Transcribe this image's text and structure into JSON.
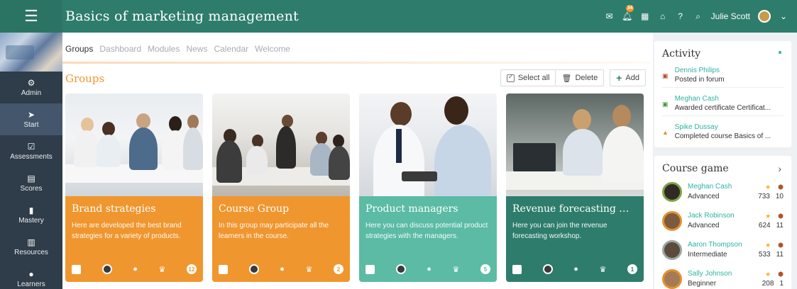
{
  "header": {
    "title": "Basics of marketing management",
    "notification_count": "34",
    "user_name": "Julie Scott"
  },
  "sidebar": {
    "items": [
      {
        "label": "Admin",
        "icon": "gear-icon"
      },
      {
        "label": "Start",
        "icon": "send-icon"
      },
      {
        "label": "Assessments",
        "icon": "checklist-icon"
      },
      {
        "label": "Scores",
        "icon": "scores-icon"
      },
      {
        "label": "Mastery",
        "icon": "bar-chart-icon"
      },
      {
        "label": "Resources",
        "icon": "books-icon"
      },
      {
        "label": "Learners",
        "icon": "person-icon"
      }
    ],
    "active": "Start"
  },
  "tabs": [
    "Groups",
    "Dashboard",
    "Modules",
    "News",
    "Calendar",
    "Welcome"
  ],
  "active_tab": "Groups",
  "section_title": "Groups",
  "actions": {
    "select_all": "Select all",
    "delete": "Delete",
    "add": "Add"
  },
  "cards": [
    {
      "title": "Brand strategies",
      "desc": "Here are developed the best brand strategies for a variety of products.",
      "count": "12",
      "color": "#f0962f"
    },
    {
      "title": "Course Group",
      "desc": "In this group may participate all the learners in the course.",
      "count": "2",
      "color": "#f0962f"
    },
    {
      "title": "Product managers",
      "desc": "Here you can discuss potential product strategies with the managers.",
      "count": "5",
      "color": "#5bbba4"
    },
    {
      "title": "Revenue forecasting wor...",
      "desc": "Here you can join the revenue forecasting workshop.",
      "count": "1",
      "color": "#2e7d6c"
    }
  ],
  "activity": {
    "title": "Activity",
    "items": [
      {
        "name": "Dennis Philips",
        "desc": "Posted in forum",
        "icon": "forum-icon"
      },
      {
        "name": "Meghan Cash",
        "desc": "Awarded certificate Certificat...",
        "icon": "certificate-icon"
      },
      {
        "name": "Spike Dussay",
        "desc": "Completed course Basics of ...",
        "icon": "course-icon"
      }
    ]
  },
  "course_game": {
    "title": "Course game",
    "players": [
      {
        "name": "Meghan Cash",
        "level": "Advanced",
        "points": "733",
        "badges": "10"
      },
      {
        "name": "Jack Robinson",
        "level": "Advanced",
        "points": "624",
        "badges": "11"
      },
      {
        "name": "Aaron Thompson",
        "level": "Intermediate",
        "points": "533",
        "badges": "11"
      },
      {
        "name": "Sally Johnson",
        "level": "Beginner",
        "points": "208",
        "badges": "1"
      }
    ]
  },
  "colors": {
    "primary": "#2e7d6c",
    "accent_orange": "#f0962f",
    "accent_teal": "#5bbba4",
    "sidebar": "#2f3c49"
  }
}
